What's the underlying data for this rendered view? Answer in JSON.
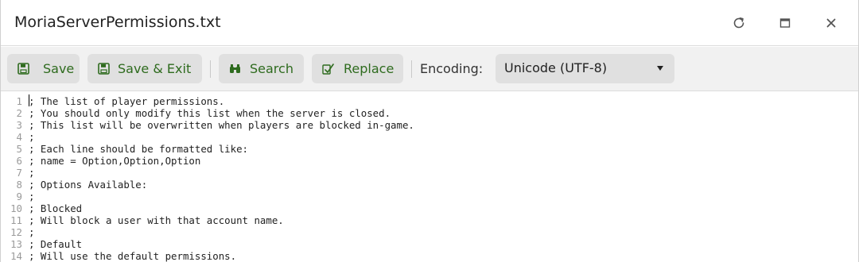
{
  "window": {
    "title": "MoriaServerPermissions.txt"
  },
  "titlebar_icons": {
    "refresh": "refresh-icon",
    "maximize": "maximize-icon",
    "close": "close-icon"
  },
  "toolbar": {
    "save_label": "Save",
    "save_exit_label": "Save & Exit",
    "search_label": "Search",
    "replace_label": "Replace",
    "encoding_label": "Encoding:",
    "encoding_value": "Unicode (UTF-8)",
    "icons": {
      "save": "save-icon",
      "save_exit": "save-icon",
      "search": "binoculars-icon",
      "replace": "replace-icon"
    },
    "accent_color": "#2e6b1e"
  },
  "editor": {
    "lines": [
      {
        "num": "1",
        "text": "; The list of player permissions."
      },
      {
        "num": "2",
        "text": "; You should only modify this list when the server is closed."
      },
      {
        "num": "3",
        "text": "; This list will be overwritten when players are blocked in-game."
      },
      {
        "num": "4",
        "text": ";"
      },
      {
        "num": "5",
        "text": "; Each line should be formatted like:"
      },
      {
        "num": "6",
        "text": "; name = Option,Option,Option"
      },
      {
        "num": "7",
        "text": ";"
      },
      {
        "num": "8",
        "text": "; Options Available:"
      },
      {
        "num": "9",
        "text": ";"
      },
      {
        "num": "10",
        "text": "; Blocked"
      },
      {
        "num": "11",
        "text": "; Will block a user with that account name."
      },
      {
        "num": "12",
        "text": ";"
      },
      {
        "num": "13",
        "text": "; Default"
      },
      {
        "num": "14",
        "text": "; Will use the default permissions."
      }
    ]
  }
}
